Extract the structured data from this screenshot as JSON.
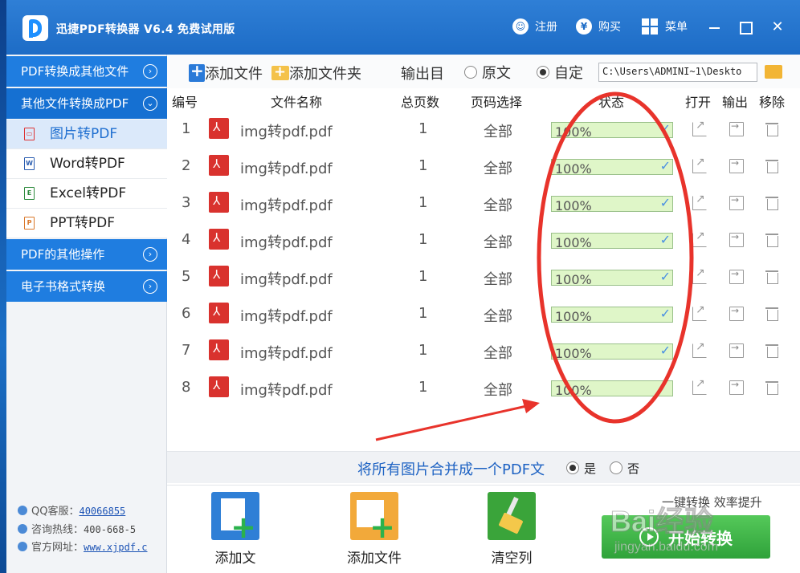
{
  "app": {
    "title": "迅捷PDF转换器 V6.4 免费试用版"
  },
  "titlebar": {
    "register": "注册",
    "buy": "购买",
    "menu": "菜单",
    "register_icon": "person-icon",
    "buy_icon": "yen-icon"
  },
  "sidebar": {
    "categories": [
      {
        "label": "PDF转换成其他文件"
      },
      {
        "label": "其他文件转换成PDF"
      },
      {
        "label": "PDF的其他操作"
      },
      {
        "label": "电子书格式转换"
      }
    ],
    "items": [
      {
        "label": "图片转PDF",
        "icon": "image-file-icon"
      },
      {
        "label": "Word转PDF",
        "icon": "word-file-icon"
      },
      {
        "label": "Excel转PDF",
        "icon": "excel-file-icon"
      },
      {
        "label": "PPT转PDF",
        "icon": "ppt-file-icon"
      }
    ],
    "contact": {
      "qq_label": "QQ客服：",
      "qq_value": "40066855",
      "hotline_label": "咨询热线：",
      "hotline_value": "400-668-5",
      "site_label": "官方网址：",
      "site_value": "www.xjpdf.c"
    }
  },
  "toolbar": {
    "add_file": "添加文件",
    "add_folder": "添加文件夹",
    "output_dir": "输出目",
    "radio_original": "原文",
    "radio_custom": "自定",
    "path_value": "C:\\Users\\ADMINI~1\\Deskto"
  },
  "table": {
    "headers": {
      "index": "编号",
      "name": "文件名称",
      "pages": "总页数",
      "page_select": "页码选择",
      "status": "状态",
      "open": "打开",
      "output": "输出",
      "remove": "移除"
    },
    "rows": [
      {
        "index": "1",
        "name": "img转pdf.pdf",
        "pages": "1",
        "page_select": "全部",
        "progress": "100%"
      },
      {
        "index": "2",
        "name": "img转pdf.pdf",
        "pages": "1",
        "page_select": "全部",
        "progress": "100%"
      },
      {
        "index": "3",
        "name": "img转pdf.pdf",
        "pages": "1",
        "page_select": "全部",
        "progress": "100%"
      },
      {
        "index": "4",
        "name": "img转pdf.pdf",
        "pages": "1",
        "page_select": "全部",
        "progress": "100%"
      },
      {
        "index": "5",
        "name": "img转pdf.pdf",
        "pages": "1",
        "page_select": "全部",
        "progress": "100%"
      },
      {
        "index": "6",
        "name": "img转pdf.pdf",
        "pages": "1",
        "page_select": "全部",
        "progress": "100%"
      },
      {
        "index": "7",
        "name": "img转pdf.pdf",
        "pages": "1",
        "page_select": "全部",
        "progress": "100%"
      },
      {
        "index": "8",
        "name": "img转pdf.pdf",
        "pages": "1",
        "page_select": "全部",
        "progress": "100%"
      }
    ]
  },
  "merge": {
    "text": "将所有图片合并成一个PDF文",
    "yes": "是",
    "no": "否"
  },
  "bottom": {
    "add_file": "添加文",
    "add_folder": "添加文件",
    "clear": "清空列",
    "tagline": "一键转换 效率提升",
    "start": "开始转换"
  },
  "watermark": {
    "brand": "Bai经验",
    "url": "jingyan.baidu.com"
  },
  "colors": {
    "titlebar": "#1d6cc6",
    "sidebar_category": "#1f7de0",
    "progress_fill": "#dff6c8",
    "annotation_red": "#e8332b",
    "start_button": "#3bb044"
  }
}
